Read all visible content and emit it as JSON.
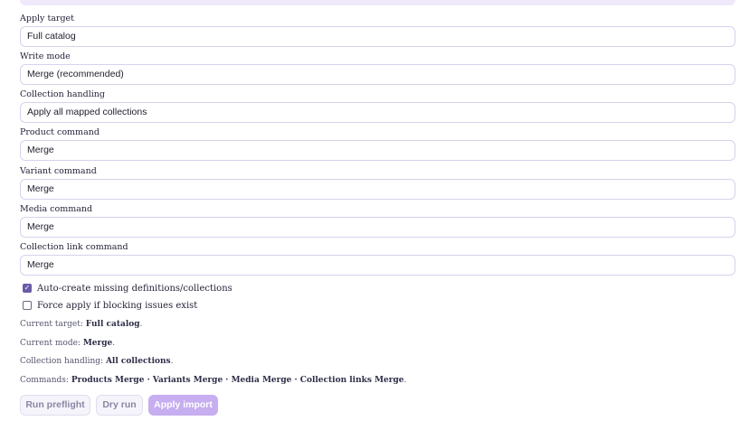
{
  "fields": [
    {
      "label": "Apply target",
      "value": "Full catalog"
    },
    {
      "label": "Write mode",
      "value": "Merge (recommended)"
    },
    {
      "label": "Collection handling",
      "value": "Apply all mapped collections"
    },
    {
      "label": "Product command",
      "value": "Merge"
    },
    {
      "label": "Variant command",
      "value": "Merge"
    },
    {
      "label": "Media command",
      "value": "Merge"
    },
    {
      "label": "Collection link command",
      "value": "Merge"
    }
  ],
  "options": {
    "auto_create": {
      "label": "Auto-create missing definitions/collections",
      "checked": true
    },
    "force_apply": {
      "label": "Force apply if blocking issues exist",
      "checked": false
    }
  },
  "summary": {
    "target": {
      "prefix": "Current target: ",
      "value": "Full catalog",
      "suffix": "."
    },
    "mode": {
      "prefix": "Current mode: ",
      "value": "Merge",
      "suffix": "."
    },
    "collections": {
      "prefix": "Collection handling: ",
      "value": "All collections",
      "suffix": "."
    },
    "commands": {
      "prefix": "Commands: ",
      "value": "Products Merge · Variants Merge · Media Merge · Collection links Merge",
      "suffix": "."
    }
  },
  "actions": {
    "preflight": "Run preflight",
    "dry_run": "Dry run",
    "apply": "Apply import"
  }
}
